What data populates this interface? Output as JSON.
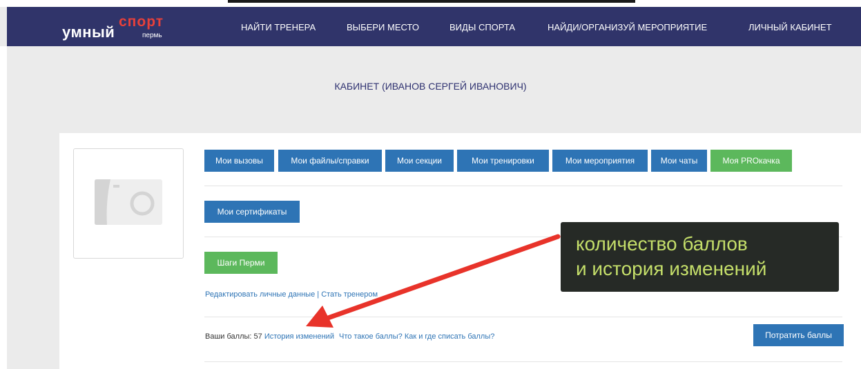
{
  "header": {
    "logo": {
      "word1": "умный",
      "word2": "спорт",
      "city": "пермь"
    },
    "nav": [
      {
        "label": "НАЙТИ ТРЕНЕРА"
      },
      {
        "label": "ВЫБЕРИ МЕСТО"
      },
      {
        "label": "ВИДЫ СПОРТА"
      },
      {
        "label": "НАЙДИ/ОРГАНИЗУЙ МЕРОПРИЯТИЕ"
      },
      {
        "label": "ЛИЧНЫЙ КАБИНЕТ"
      }
    ]
  },
  "page": {
    "title": "КАБИНЕТ (ИВАНОВ СЕРГЕЙ ИВАНОВИЧ)"
  },
  "avatar": {
    "icon": "camera-icon"
  },
  "tabs": [
    {
      "label": "Мои вызовы"
    },
    {
      "label": "Мои файлы/справки"
    },
    {
      "label": "Мои секции"
    },
    {
      "label": "Мои тренировки"
    },
    {
      "label": "Мои мероприятия"
    },
    {
      "label": "Мои чаты"
    },
    {
      "label": "Моя PROкачка"
    }
  ],
  "certificates_button": "Мои сертификаты",
  "steps_button": "Шаги Перми",
  "edit_links": {
    "edit": "Редактировать личные данные",
    "separator": "|",
    "become_trainer": "Стать тренером"
  },
  "points": {
    "label": "Ваши баллы:",
    "value": "57",
    "history_link": "История изменений",
    "what_link": "Что такое баллы?",
    "how_link": "Как и где списать баллы?",
    "spend_button": "Потратить баллы"
  },
  "callout": {
    "line1": "количество баллов",
    "line2": "и история изменений"
  },
  "colors": {
    "navbar": "#30346a",
    "accent_blue": "#2e74b5",
    "accent_green": "#5cb85c",
    "logo_red": "#e8403a",
    "callout_bg": "#262a26",
    "callout_text": "#c5df6a",
    "arrow": "#e8332a"
  }
}
